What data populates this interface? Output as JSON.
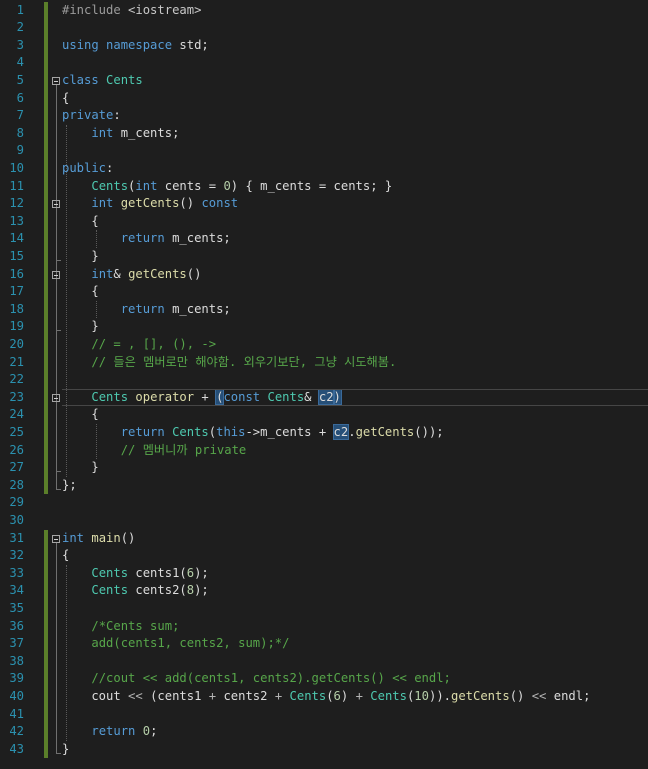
{
  "editor": {
    "lines": [
      {
        "n": "1",
        "t": [
          [
            "pp",
            "#include "
          ],
          [
            "pr",
            "<iostream>"
          ]
        ]
      },
      {
        "n": "2",
        "t": []
      },
      {
        "n": "3",
        "t": [
          [
            "kw",
            "using"
          ],
          [
            "pl",
            " "
          ],
          [
            "kw",
            "namespace"
          ],
          [
            "pl",
            " std;"
          ]
        ]
      },
      {
        "n": "4",
        "t": []
      },
      {
        "n": "5",
        "t": [
          [
            "kw",
            "class"
          ],
          [
            "pl",
            " "
          ],
          [
            "ty",
            "Cents"
          ]
        ]
      },
      {
        "n": "6",
        "t": [
          [
            "pl",
            "{"
          ]
        ]
      },
      {
        "n": "7",
        "t": [
          [
            "kw",
            "private"
          ],
          [
            "pl",
            ":"
          ]
        ]
      },
      {
        "n": "8",
        "t": [
          [
            "pl",
            "    "
          ],
          [
            "kw",
            "int"
          ],
          [
            "pl",
            " m_cents;"
          ]
        ]
      },
      {
        "n": "9",
        "t": []
      },
      {
        "n": "10",
        "t": [
          [
            "kw",
            "public"
          ],
          [
            "pl",
            ":"
          ]
        ]
      },
      {
        "n": "11",
        "t": [
          [
            "pl",
            "    "
          ],
          [
            "ty",
            "Cents"
          ],
          [
            "pl",
            "("
          ],
          [
            "kw",
            "int"
          ],
          [
            "pl",
            " cents = "
          ],
          [
            "nm",
            "0"
          ],
          [
            "pl",
            ") { m_cents = cents; }"
          ]
        ]
      },
      {
        "n": "12",
        "t": [
          [
            "pl",
            "    "
          ],
          [
            "kw",
            "int"
          ],
          [
            "pl",
            " "
          ],
          [
            "fn",
            "getCents"
          ],
          [
            "pl",
            "() "
          ],
          [
            "kw",
            "const"
          ]
        ]
      },
      {
        "n": "13",
        "t": [
          [
            "pl",
            "    {"
          ]
        ]
      },
      {
        "n": "14",
        "t": [
          [
            "pl",
            "        "
          ],
          [
            "kw",
            "return"
          ],
          [
            "pl",
            " m_cents;"
          ]
        ]
      },
      {
        "n": "15",
        "t": [
          [
            "pl",
            "    }"
          ]
        ]
      },
      {
        "n": "16",
        "t": [
          [
            "pl",
            "    "
          ],
          [
            "kw",
            "int"
          ],
          [
            "pl",
            "& "
          ],
          [
            "fn",
            "getCents"
          ],
          [
            "pl",
            "()"
          ]
        ]
      },
      {
        "n": "17",
        "t": [
          [
            "pl",
            "    {"
          ]
        ]
      },
      {
        "n": "18",
        "t": [
          [
            "pl",
            "        "
          ],
          [
            "kw",
            "return"
          ],
          [
            "pl",
            " m_cents;"
          ]
        ]
      },
      {
        "n": "19",
        "t": [
          [
            "pl",
            "    }"
          ]
        ]
      },
      {
        "n": "20",
        "t": [
          [
            "pl",
            "    "
          ],
          [
            "cm",
            "// = , [], (), ->"
          ]
        ]
      },
      {
        "n": "21",
        "t": [
          [
            "pl",
            "    "
          ],
          [
            "cm",
            "// 들은 멤버로만 해야함. 외우기보단, 그냥 시도해봄."
          ]
        ]
      },
      {
        "n": "22",
        "t": []
      },
      {
        "n": "23",
        "t": [
          [
            "pl",
            "    "
          ],
          [
            "ty",
            "Cents"
          ],
          [
            "pl",
            " "
          ],
          [
            "fn",
            "operator"
          ],
          [
            "pl",
            " + "
          ],
          [
            "hl",
            "("
          ],
          [
            "kw",
            "const"
          ],
          [
            "pl",
            " "
          ],
          [
            "ty",
            "Cents"
          ],
          [
            "pl",
            "& "
          ],
          [
            "hl",
            "c2"
          ],
          [
            "hl",
            ")"
          ]
        ]
      },
      {
        "n": "24",
        "t": [
          [
            "pl",
            "    {"
          ]
        ]
      },
      {
        "n": "25",
        "t": [
          [
            "pl",
            "        "
          ],
          [
            "kw",
            "return"
          ],
          [
            "pl",
            " "
          ],
          [
            "ty",
            "Cents"
          ],
          [
            "pl",
            "("
          ],
          [
            "kw",
            "this"
          ],
          [
            "pl",
            "->m_cents + "
          ],
          [
            "hl",
            "c2"
          ],
          [
            "pl",
            "."
          ],
          [
            "fn",
            "getCents"
          ],
          [
            "pl",
            "());"
          ]
        ]
      },
      {
        "n": "26",
        "t": [
          [
            "pl",
            "        "
          ],
          [
            "cm",
            "// 멤버니까 private"
          ]
        ]
      },
      {
        "n": "27",
        "t": [
          [
            "pl",
            "    }"
          ]
        ]
      },
      {
        "n": "28",
        "t": [
          [
            "pl",
            "};"
          ]
        ]
      },
      {
        "n": "29",
        "t": []
      },
      {
        "n": "30",
        "t": []
      },
      {
        "n": "31",
        "t": [
          [
            "kw",
            "int"
          ],
          [
            "pl",
            " "
          ],
          [
            "fn",
            "main"
          ],
          [
            "pl",
            "()"
          ]
        ]
      },
      {
        "n": "32",
        "t": [
          [
            "pl",
            "{"
          ]
        ]
      },
      {
        "n": "33",
        "t": [
          [
            "pl",
            "    "
          ],
          [
            "ty",
            "Cents"
          ],
          [
            "pl",
            " cents1("
          ],
          [
            "nm",
            "6"
          ],
          [
            "pl",
            ");"
          ]
        ]
      },
      {
        "n": "34",
        "t": [
          [
            "pl",
            "    "
          ],
          [
            "ty",
            "Cents"
          ],
          [
            "pl",
            " cents2("
          ],
          [
            "nm",
            "8"
          ],
          [
            "pl",
            ");"
          ]
        ]
      },
      {
        "n": "35",
        "t": []
      },
      {
        "n": "36",
        "t": [
          [
            "pl",
            "    "
          ],
          [
            "cm",
            "/*Cents sum;"
          ]
        ]
      },
      {
        "n": "37",
        "t": [
          [
            "pl",
            "    "
          ],
          [
            "cm",
            "add(cents1, cents2, sum);*/"
          ]
        ]
      },
      {
        "n": "38",
        "t": []
      },
      {
        "n": "39",
        "t": [
          [
            "pl",
            "    "
          ],
          [
            "cm",
            "//cout << add(cents1, cents2).getCents() << endl;"
          ]
        ]
      },
      {
        "n": "40",
        "t": [
          [
            "pl",
            "    cout "
          ],
          [
            "op",
            "<<"
          ],
          [
            "pl",
            " (cents1 "
          ],
          [
            "op",
            "+"
          ],
          [
            "pl",
            " cents2 "
          ],
          [
            "op",
            "+"
          ],
          [
            "pl",
            " "
          ],
          [
            "ty",
            "Cents"
          ],
          [
            "pl",
            "("
          ],
          [
            "nm",
            "6"
          ],
          [
            "pl",
            ") "
          ],
          [
            "op",
            "+"
          ],
          [
            "pl",
            " "
          ],
          [
            "ty",
            "Cents"
          ],
          [
            "pl",
            "("
          ],
          [
            "nm",
            "10"
          ],
          [
            "pl",
            "))."
          ],
          [
            "fn",
            "getCents"
          ],
          [
            "pl",
            "() "
          ],
          [
            "op",
            "<<"
          ],
          [
            "pl",
            " endl;"
          ]
        ]
      },
      {
        "n": "41",
        "t": []
      },
      {
        "n": "42",
        "t": [
          [
            "pl",
            "    "
          ],
          [
            "kw",
            "return"
          ],
          [
            "pl",
            " "
          ],
          [
            "nm",
            "0"
          ],
          [
            "pl",
            ";"
          ]
        ]
      },
      {
        "n": "43",
        "t": [
          [
            "pl",
            "}"
          ]
        ]
      }
    ]
  },
  "colors": {
    "background": "#1e1e1e",
    "line_number": "#2b91af",
    "keyword": "#569cd6",
    "type": "#4ec9b0",
    "function": "#dcdcaa",
    "comment": "#57a64a",
    "number": "#b5cea8",
    "reference_highlight": "#264f78",
    "change_bar": "#5b7f2a"
  }
}
